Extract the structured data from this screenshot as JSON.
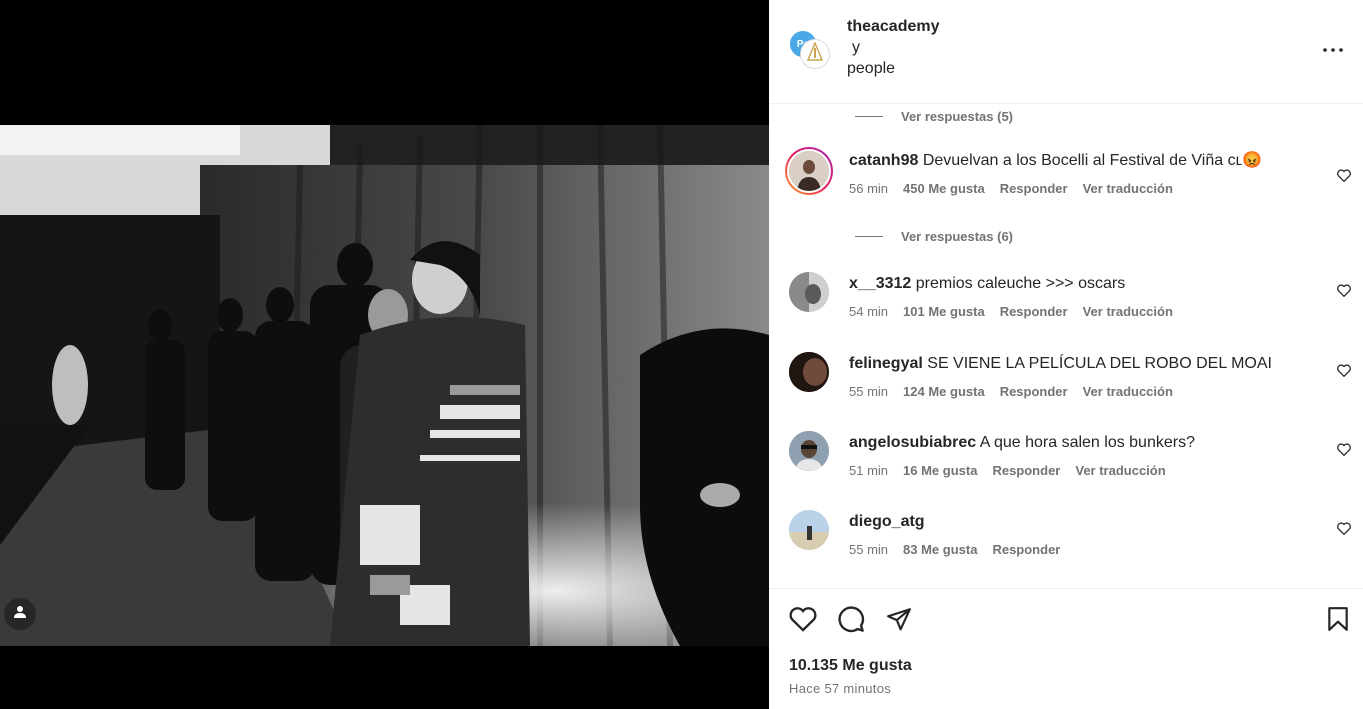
{
  "post": {
    "owners": [
      "theacademy",
      "people"
    ],
    "owner_joiner": "y",
    "likes_count": "10.135 Me gusta",
    "time_ago": "Hace 57 minutos",
    "avatar_back_text": "Pe"
  },
  "comments": [
    {
      "replies_label": "Ver respuestas (5)"
    },
    {
      "username": "catanh98",
      "text": "Devuelvan a los Bocelli al Festival de Viña cʟ",
      "emoji": "😡",
      "time": "56 min",
      "likes": "450 Me gusta",
      "reply": "Responder",
      "translate": "Ver traducción",
      "replies_label": "Ver respuestas (6)"
    },
    {
      "username": "x__3312",
      "text": "premios caleuche >>> oscars",
      "time": "54 min",
      "likes": "101 Me gusta",
      "reply": "Responder",
      "translate": "Ver traducción"
    },
    {
      "username": "felinegyal",
      "text": "SE VIENE LA PELÍCULA DEL ROBO DEL MOAI",
      "time": "55 min",
      "likes": "124 Me gusta",
      "reply": "Responder",
      "translate": "Ver traducción"
    },
    {
      "username": "angelosubiabrec",
      "text": "A que hora salen los bunkers?",
      "time": "51 min",
      "likes": "16 Me gusta",
      "reply": "Responder",
      "translate": "Ver traducción"
    },
    {
      "username": "diego_atg",
      "text": "",
      "time": "55 min",
      "likes": "83 Me gusta",
      "reply": "Responder"
    }
  ],
  "icons": {
    "more": "more-horizontal-icon",
    "like": "heart-icon",
    "comment": "comment-icon",
    "share": "paper-plane-icon",
    "save": "bookmark-icon",
    "tag": "user-tag-icon"
  },
  "colors": {
    "text": "#262626",
    "secondary": "#737373",
    "story_ring_start": "#f9a825",
    "story_ring_end": "#c2185b",
    "divider": "#efefef"
  }
}
